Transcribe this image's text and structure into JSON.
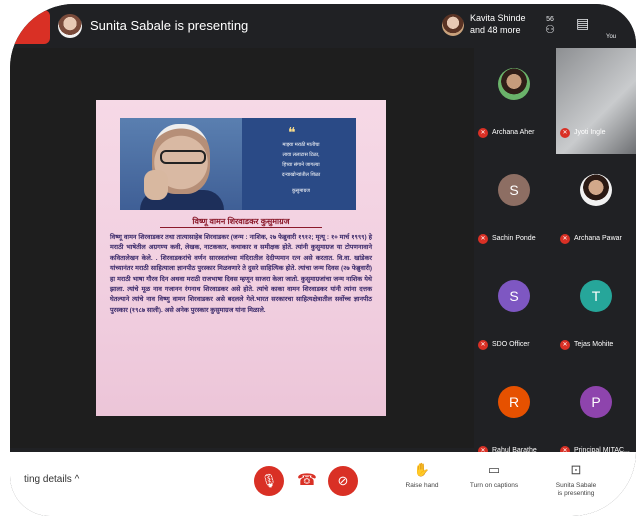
{
  "header": {
    "presenting_text": "Sunita Sabale is presenting",
    "participant_line1": "Kavita Shinde",
    "participant_line2": "and 48 more",
    "participants_count": "56",
    "you_label": "You"
  },
  "slide": {
    "quote_mark": "❝",
    "quote_lines": [
      "माझ्या मराठी मातीचा",
      "लावा ललाटास टिळा,",
      "हिच्या संगाने जागल्या",
      "दऱ्याखोऱ्यांतील शिळा",
      "कुसुमाग्रज"
    ],
    "title": "विष्णू वामन शिरवाडकर कुसुमाग्रज",
    "body": "विष्णू वामन शिरवाडकर तथा तात्यासाहेब शिरवाडकर (जन्म : नाशिक, २७ फेब्रुवारी १९१२; मृत्यू : १० मार्च १९९९) हे मराठी भाषेतील अग्रगण्य कवी, लेखक, नाटककार, कथाकार व समीक्षक होते. त्यांनी कुसुमाग्रज या टोपणनावाने कवितालेखन केले. . शिरवाडकरांचे वर्णन सारस्वतांच्या मंदिरातील देदीप्यमान रत्न असे करतात. वि.वा. खांडेकर यांच्यानंतर मराठी साहित्याला ज्ञानपीठ पुरस्कार मिळवणारे ते दुसरे साहित्यिक होते. त्यांचा जन्म दिवस (२७ फेब्रुवारी) हा मराठी भाषा गौरव दिन अथवा मराठी राजभाषा दिवस म्हणून साजरा केला जातो. कुसुमाग्रजांचा जन्म नाशिक येथे झाला. त्यांचे मूळ नाव गजानन रंगनाथ शिरवाडकर असे होते. त्यांचे काका वामन शिरवाडकर यांनी त्यांना दत्तक घेतल्याने त्यांचे नाव विष्णु वामन शिरवाडकर असे बदलले गेले.भारत सरकारचा साहित्यक्षेत्रातील सर्वोच्च ज्ञानपीठ पुरस्कार (१९८७ साली). असे अनेक पुरस्कार कुसुमाग्रज यांना मिळाले."
  },
  "participants": [
    {
      "name": "Archana Aher",
      "initial": "",
      "color": ""
    },
    {
      "name": "Jyoti Ingle",
      "initial": "",
      "color": ""
    },
    {
      "name": "Sachin Ponde",
      "initial": "S",
      "color": "#8d6e63"
    },
    {
      "name": "Archana Pawar",
      "initial": "",
      "color": ""
    },
    {
      "name": "SDO Officer",
      "initial": "S",
      "color": "#7e57c2"
    },
    {
      "name": "Tejas Mohite",
      "initial": "T",
      "color": "#26a69a"
    },
    {
      "name": "Rahul Barathe",
      "initial": "R",
      "color": "#e65100"
    },
    {
      "name": "Principal MITAC...",
      "initial": "P",
      "color": "#8e44ad"
    }
  ],
  "footer": {
    "details_text": "ting details",
    "raise_hand": "Raise hand",
    "captions": "Turn on captions",
    "presenting_line1": "Sunita Sabale",
    "presenting_line2": "is presenting"
  },
  "colors": {
    "mic_off": "#d93025",
    "background": "#202124"
  }
}
